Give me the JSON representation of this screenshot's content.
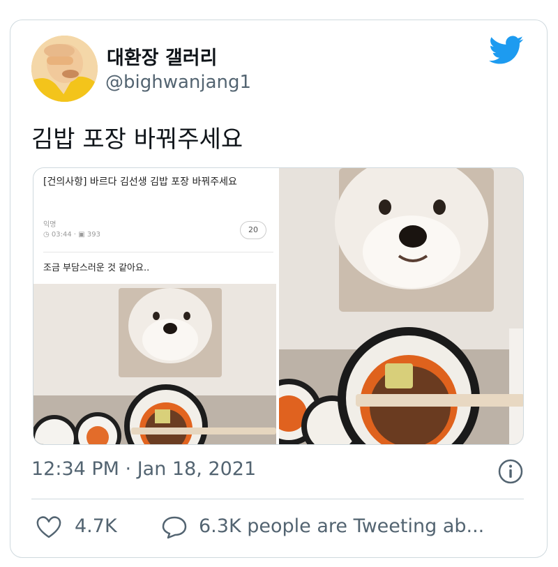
{
  "user": {
    "display_name": "대환장 갤러리",
    "handle": "@bighwanjang1"
  },
  "tweet": {
    "text": "김밥 포장 바꿔주세요",
    "timestamp": "12:34 PM · Jan 18, 2021"
  },
  "embedded_post": {
    "title": "[건의사항] 바르다 김선생 김밥 포장 바꿔주세요",
    "author": "익명",
    "meta": "◷ 03:44 · ▣ 393",
    "comment_count": "20",
    "body": "조금 부담스러운 것 같아요.."
  },
  "actions": {
    "like_count": "4.7K",
    "reply_text": "6.3K people are Tweeting ab..."
  },
  "colors": {
    "twitter_blue": "#1d9bf0",
    "secondary_text": "#536471",
    "border": "#cfd9de"
  },
  "icons": {
    "logo": "twitter-bird-icon",
    "info": "info-icon",
    "like": "heart-icon",
    "reply": "speech-bubble-icon"
  }
}
